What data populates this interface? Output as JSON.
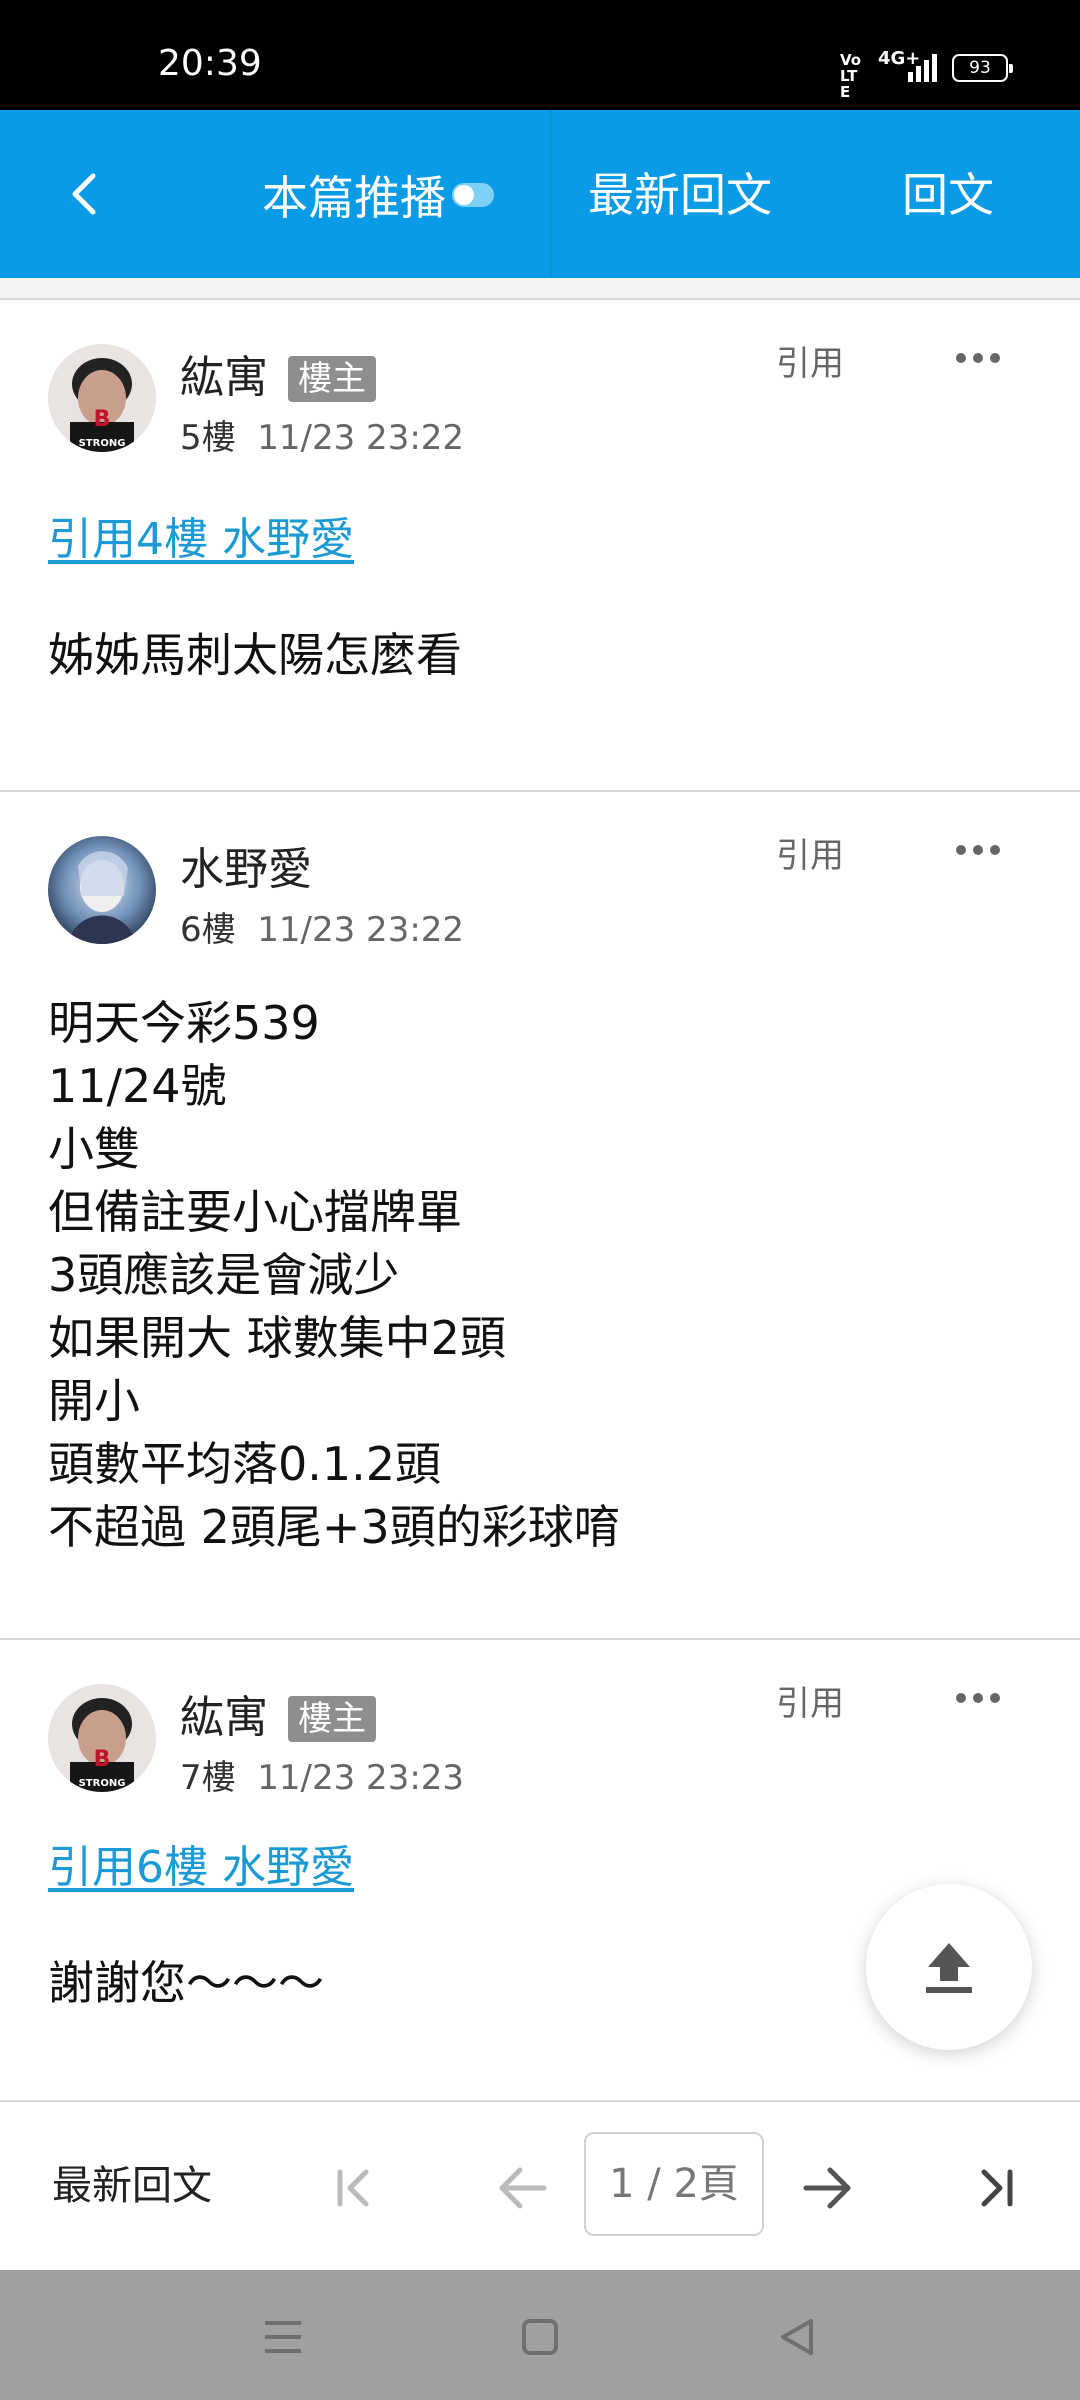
{
  "status_bar": {
    "time": "20:39",
    "volte": "Vo LTE",
    "network": "4G+",
    "battery": "93"
  },
  "topbar": {
    "back_icon": "chevron-left-icon",
    "push_label": "本篇推播",
    "latest_label": "最新回文",
    "reply_label": "回文",
    "color": "#0a9be6"
  },
  "posts": [
    {
      "author": "紘寓",
      "badge": "樓主",
      "floor": "5樓",
      "time": "11/23 23:22",
      "quote_button": "引用",
      "quote_link": "引用4樓 水野愛",
      "body": "姊姊馬刺太陽怎麼看"
    },
    {
      "author": "水野愛",
      "badge": "",
      "floor": "6樓",
      "time": "11/23 23:22",
      "quote_button": "引用",
      "body_lines": [
        "明天今彩539",
        "11/24號",
        "小雙",
        "但備註要小心擋牌單",
        "3頭應該是會減少",
        "如果開大 球數集中2頭",
        "開小",
        "頭數平均落0.1.2頭",
        "不超過 2頭尾+3頭的彩球唷"
      ]
    },
    {
      "author": "紘寓",
      "badge": "樓主",
      "floor": "7樓",
      "time": "11/23 23:23",
      "quote_button": "引用",
      "quote_link": "引用6樓 水野愛",
      "body": "謝謝您～～～"
    }
  ],
  "bottombar": {
    "latest_label": "最新回文",
    "page_indicator": "1 / 2頁"
  },
  "colors": {
    "link": "#1a9ad6",
    "badge": "#8e8e8e"
  }
}
